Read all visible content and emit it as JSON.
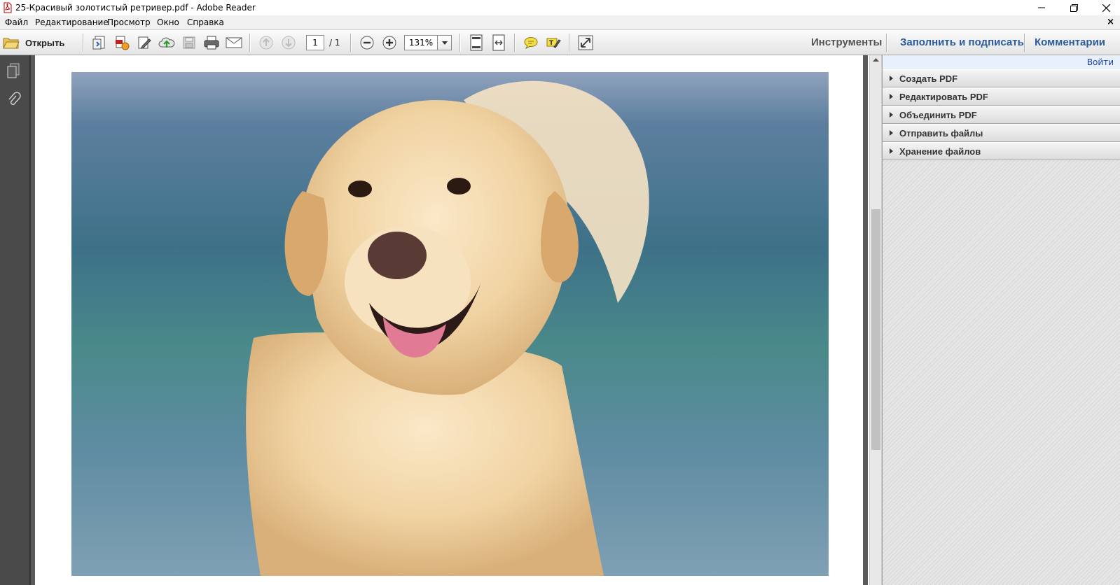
{
  "window": {
    "title": "25-Красивый золотистый ретривер.pdf - Adobe Reader",
    "app_icon": "adobe-pdf-icon",
    "controls": [
      "minimize-icon",
      "restore-icon",
      "close-icon"
    ]
  },
  "menu": {
    "items": [
      "Файл",
      "Редактирование",
      "Просмотр",
      "Окно",
      "Справка"
    ],
    "close_doc": "×"
  },
  "toolbar": {
    "open_label": "Открыть",
    "page_current": "1",
    "page_total": "/ 1",
    "zoom": "131%",
    "tabs": {
      "tools": "Инструменты",
      "fill_sign": "Заполнить и подписать",
      "comments": "Комментарии"
    }
  },
  "right_panel": {
    "login": "Войти",
    "sections": [
      "Создать PDF",
      "Редактировать PDF",
      "Объединить PDF",
      "Отправить файлы",
      "Хранение файлов"
    ]
  },
  "colors": {
    "tab_blue": "#2b5b9a",
    "tab_gray": "#555555",
    "link_blue": "#1a3ea8"
  }
}
